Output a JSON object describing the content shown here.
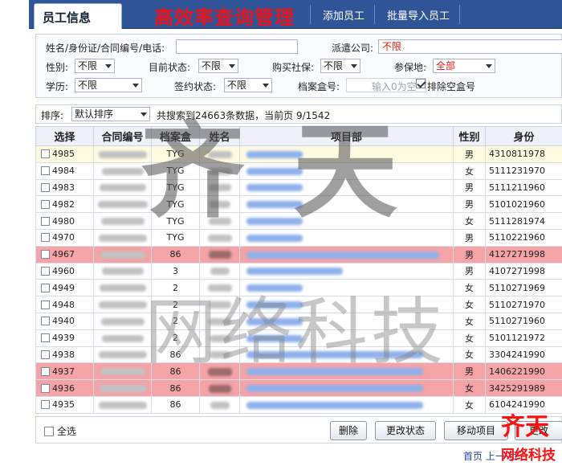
{
  "header": {
    "tabs": [
      {
        "label": "员工信息",
        "active": true
      },
      {
        "label": "添加员工",
        "active": false
      },
      {
        "label": "批量导入员工",
        "active": false
      }
    ],
    "brand_title": "高效率查询管理"
  },
  "filters": {
    "name_label": "姓名/身份证/合同编号/电话:",
    "name_value": "",
    "company_label": "派遣公司:",
    "company_value": "不限",
    "gender_label": "性别:",
    "gender_value": "不限",
    "status_label": "目前状态:",
    "status_value": "不限",
    "insurance_label": "购买社保:",
    "insurance_value": "不限",
    "place_label": "参保地:",
    "place_value": "全部",
    "edu_label": "学历:",
    "edu_value": "不限",
    "sign_label": "签约状态:",
    "sign_value": "不限",
    "archive_label": "档案盒号:",
    "archive_placeholder": "输入0为空",
    "exclude_label": "排除空盒号",
    "exclude_checked": true
  },
  "sortbar": {
    "label": "排序:",
    "value": "默认排序",
    "info": "共搜索到24663条数据，当前页 9/1542"
  },
  "table": {
    "columns": [
      "选择",
      "合同编号",
      "档案盒",
      "姓名",
      "项目部",
      "性别",
      "身份"
    ],
    "rows": [
      {
        "id": "4985",
        "box": "TYG",
        "gender": "男",
        "idcard": "4310811978",
        "style": "highlight"
      },
      {
        "id": "4984",
        "box": "TYG",
        "gender": "女",
        "idcard": "5111231970",
        "style": ""
      },
      {
        "id": "4983",
        "box": "TYG",
        "gender": "男",
        "idcard": "5111211960",
        "style": ""
      },
      {
        "id": "4982",
        "box": "TYG",
        "gender": "男",
        "idcard": "5101021960",
        "style": ""
      },
      {
        "id": "4980",
        "box": "TYG",
        "gender": "女",
        "idcard": "5111281974",
        "style": ""
      },
      {
        "id": "4970",
        "box": "TYG",
        "gender": "男",
        "idcard": "5110221960",
        "style": ""
      },
      {
        "id": "4967",
        "box": "86",
        "gender": "男",
        "idcard": "4127271998",
        "style": "red"
      },
      {
        "id": "4960",
        "box": "3",
        "gender": "男",
        "idcard": "4107271998",
        "style": ""
      },
      {
        "id": "4949",
        "box": "2",
        "gender": "女",
        "idcard": "5110271969",
        "style": ""
      },
      {
        "id": "4948",
        "box": "2",
        "gender": "女",
        "idcard": "5110271970",
        "style": ""
      },
      {
        "id": "4940",
        "box": "2",
        "gender": "女",
        "idcard": "5110271960",
        "style": ""
      },
      {
        "id": "4939",
        "box": "2",
        "gender": "女",
        "idcard": "5101121972",
        "style": ""
      },
      {
        "id": "4938",
        "box": "86",
        "gender": "女",
        "idcard": "3304241990",
        "style": ""
      },
      {
        "id": "4937",
        "box": "86",
        "gender": "男",
        "idcard": "1406221990",
        "style": "red"
      },
      {
        "id": "4936",
        "box": "86",
        "gender": "女",
        "idcard": "3425291989",
        "style": "red"
      },
      {
        "id": "4935",
        "box": "86",
        "gender": "女",
        "idcard": "6104241990",
        "style": ""
      }
    ]
  },
  "actions": {
    "select_all": "全选",
    "delete": "删除",
    "change_status": "更改状态",
    "move_project": "移动项目",
    "more": "更改"
  },
  "pager": {
    "first": "首页",
    "prev": "上一",
    "current": "页"
  },
  "watermark": {
    "big": "齐天",
    "net": "网络科技",
    "logo_top": "齐天",
    "logo_bottom": "网络科技"
  },
  "colors": {
    "tab_bar": "#2f5596",
    "brand_red": "#e8141b",
    "row_red": "#f4a3a7",
    "row_highlight": "#fffbe0"
  }
}
